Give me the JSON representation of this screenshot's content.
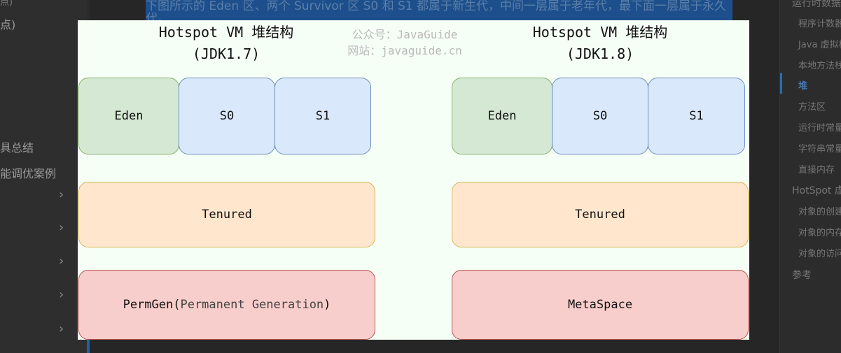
{
  "background_page": {
    "highlighted_text": "下图所示的 Eden 区、两个 Survivor 区 S0 和 S1 都属于新生代，中间一层属于老年代，最下面一层属于永久代。",
    "left_sidebar": {
      "top_fragment": "点)",
      "item_1": "点)",
      "item_2": "具总结",
      "item_3": "能调优案例"
    },
    "toc": {
      "items": [
        "运行时数据",
        "程序计数器",
        "Java 虚拟机",
        "本地方法栈",
        "堆",
        "方法区",
        "运行时常量",
        "字符串常量",
        "直接内存",
        "HotSpot 虚",
        "对象的创建",
        "对象的内存",
        "对象的访问",
        "参考"
      ]
    }
  },
  "figure": {
    "left": {
      "title_line1": "Hotspot VM  堆结构",
      "title_line2": "(JDK1.7)",
      "eden": "Eden",
      "s0": "S0",
      "s1": "S1",
      "tenured": "Tenured",
      "perm_prefix": "PermGen(",
      "perm_inner": "Permanent Generation",
      "perm_suffix": ")"
    },
    "right": {
      "title_line1": "Hotspot VM  堆结构",
      "title_line2": "(JDK1.8)",
      "eden": "Eden",
      "s0": "S0",
      "s1": "S1",
      "tenured": "Tenured",
      "metaspace": "MetaSpace"
    },
    "watermark": {
      "line1": "公众号：JavaGuide",
      "line2": "网站：javaguide.cn"
    }
  }
}
